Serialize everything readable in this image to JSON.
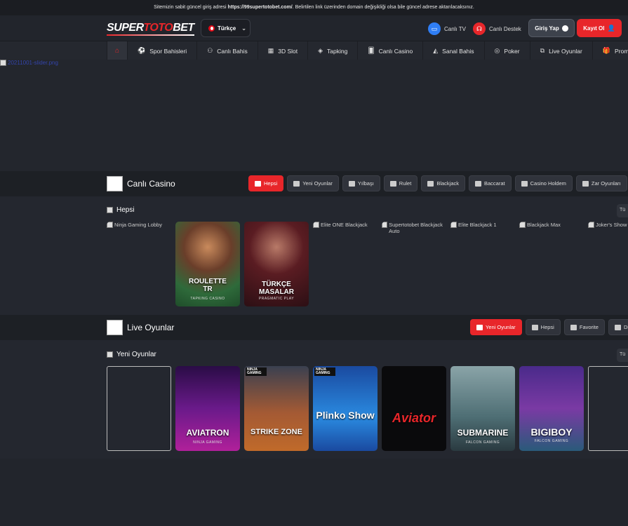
{
  "notice": {
    "prefix": "Sitemizin sabit güncel giriş adresi ",
    "url": "https://99supertotobet.com/",
    "suffix": ". Belirtilen link üzerinden domain değişikliği olsa bile güncel adrese aktarılacaksınız."
  },
  "header": {
    "logo_white": "SUPER",
    "logo_red": "TOTO",
    "logo_white2": "BET",
    "language": "Türkçe",
    "canli_tv": "Canlı TV",
    "canli_destek": "Canlı Destek",
    "login": "Giriş Yap",
    "register": "Kayıt Ol"
  },
  "nav": {
    "items": [
      {
        "label": "Spor Bahisleri",
        "icon": "soccer-ball-icon",
        "glyph": "⚽"
      },
      {
        "label": "Canlı Bahis",
        "icon": "live-bet-icon",
        "glyph": "⚇"
      },
      {
        "label": "3D Slot",
        "icon": "slot-icon",
        "glyph": "▦"
      },
      {
        "label": "Tapking",
        "icon": "tapking-icon",
        "glyph": "◈"
      },
      {
        "label": "Canlı Casino",
        "icon": "cards-icon",
        "glyph": "🂠"
      },
      {
        "label": "Sanal Bahis",
        "icon": "virtual-icon",
        "glyph": "◭"
      },
      {
        "label": "Poker",
        "icon": "chips-icon",
        "glyph": "◎"
      },
      {
        "label": "Live Oyunlar",
        "icon": "live-games-icon",
        "glyph": "⧉"
      },
      {
        "label": "Promos",
        "icon": "gift-icon",
        "glyph": "🎁"
      }
    ]
  },
  "banner": {
    "alt": "20211001-slider.png"
  },
  "casino": {
    "title": "Canlı Casino",
    "chips": [
      "Hepsi",
      "Yeni Oyunlar",
      "Yılbaşı",
      "Rulet",
      "Blackjack",
      "Baccarat",
      "Casino Holdem",
      "Zar Oyunları"
    ],
    "sub_title": "Hepsi",
    "more": "Tü",
    "games": [
      {
        "alt": "Ninja Gaming Lobby"
      },
      {
        "name": "ROULETTE TR",
        "provider": "TAPKING CASINO"
      },
      {
        "name": "TÜRKÇE MASALAR",
        "provider": "PRAGMATIC PLAY"
      },
      {
        "alt": "Elite ONE Blackjack"
      },
      {
        "alt": "Supertotobet Blackjack Auto"
      },
      {
        "alt": "Elite Blackjack 1"
      },
      {
        "alt": "Blackjack Max"
      },
      {
        "alt": "Joker's Show"
      }
    ]
  },
  "live": {
    "title": "Live Oyunlar",
    "chips": [
      "Yeni Oyunlar",
      "Hepsi",
      "Favorite",
      "Diğer"
    ],
    "sub_title": "Yeni Oyunlar",
    "more": "Tü",
    "games": [
      {
        "name": ""
      },
      {
        "name": "AVIATRON",
        "provider": "NINJA GAMING"
      },
      {
        "name": "STRIKE ZONE",
        "badge": "NINJA GAMING"
      },
      {
        "name": "Plinko Show",
        "badge": "NINJA GAMING"
      },
      {
        "name": "Aviator"
      },
      {
        "name": "SUBMARINE",
        "provider": "FALCON GAMING"
      },
      {
        "name": "BIGIBOY",
        "provider": "FALCON GAMING"
      },
      {
        "name": ""
      }
    ]
  }
}
